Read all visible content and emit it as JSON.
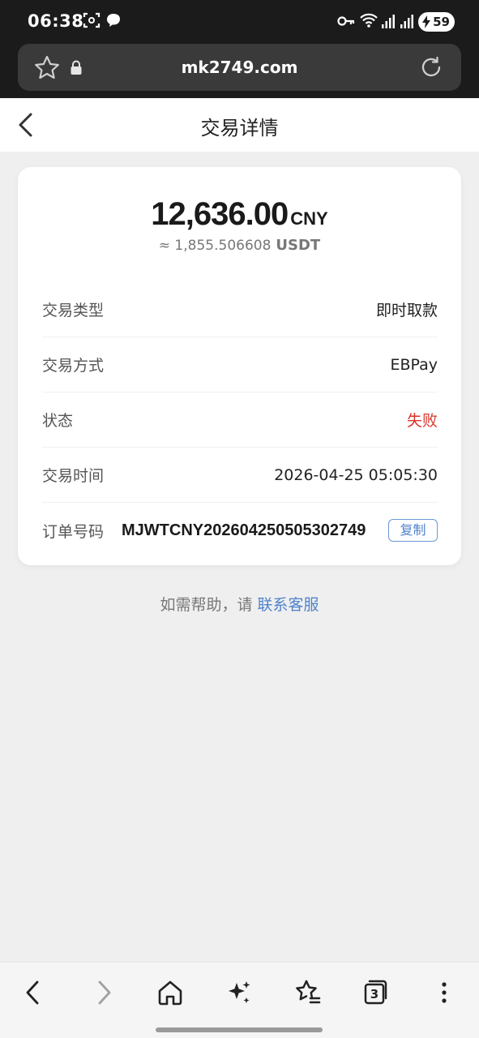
{
  "status_bar": {
    "time": "06:38",
    "battery": "59"
  },
  "browser": {
    "url": "mk2749.com"
  },
  "header": {
    "title": "交易详情"
  },
  "transaction": {
    "amount": "12,636.00",
    "currency": "CNY",
    "approx": "≈ 1,855.506608",
    "approx_currency": "USDT",
    "rows": [
      {
        "label": "交易类型",
        "value": "即时取款"
      },
      {
        "label": "交易方式",
        "value": "EBPay"
      },
      {
        "label": "状态",
        "value": "失败"
      },
      {
        "label": "交易时间",
        "value": "2026-04-25 05:05:30"
      },
      {
        "label": "订单号码",
        "value": "MJWTCNY202604250505302749"
      }
    ],
    "copy_label": "复制"
  },
  "help": {
    "prefix": "如需帮助，请",
    "link": "联系客服"
  },
  "colors": {
    "fail_red": "#d9342b",
    "link_blue": "#4f82cb",
    "page_bg": "#efefef"
  },
  "icons": {
    "bottom_nav": [
      "back-icon",
      "forward-icon",
      "home-icon",
      "sparkle-icon",
      "bookmark-star-icon",
      "tabs-icon",
      "more-icon"
    ],
    "tab_count": "3"
  }
}
